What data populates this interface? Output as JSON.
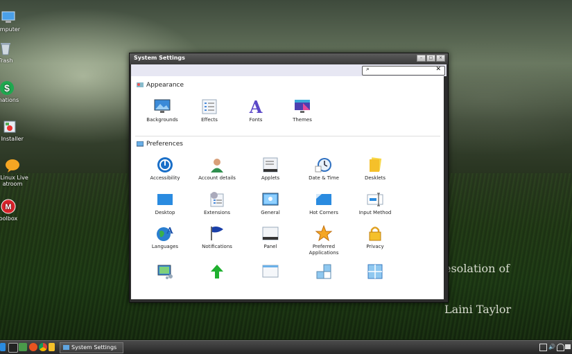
{
  "desktop": {
    "icons": [
      {
        "label": "omputer",
        "icon": "computer-icon"
      },
      {
        "label": "Trash",
        "icon": "trash-icon"
      },
      {
        "label": "onations",
        "icon": "donations-icon"
      },
      {
        "label": "e Installer",
        "icon": "installer-icon"
      },
      {
        "label": "uLinux Live\natroom",
        "icon": "chat-icon"
      },
      {
        "label": "oolbox",
        "icon": "toolbox-icon"
      }
    ],
    "quote": {
      "line": "esolation of",
      "author": "Laini Taylor"
    }
  },
  "window": {
    "title": "System Settings",
    "controls": [
      "minimize",
      "maximize",
      "close"
    ],
    "search": {
      "placeholder": "",
      "value": "",
      "icon": "search-icon",
      "clear_icon": "clear-icon"
    },
    "sections": [
      {
        "name": "Appearance",
        "icon": "appearance-icon",
        "items": [
          {
            "label": "Backgrounds",
            "icon": "backgrounds-icon"
          },
          {
            "label": "Effects",
            "icon": "effects-icon"
          },
          {
            "label": "Fonts",
            "icon": "fonts-icon"
          },
          {
            "label": "Themes",
            "icon": "themes-icon"
          }
        ]
      },
      {
        "name": "Preferences",
        "icon": "preferences-icon",
        "items": [
          {
            "label": "Accessibility",
            "icon": "accessibility-icon"
          },
          {
            "label": "Account details",
            "icon": "account-icon"
          },
          {
            "label": "Applets",
            "icon": "applets-icon"
          },
          {
            "label": "Date & Time",
            "icon": "clock-icon"
          },
          {
            "label": "Desklets",
            "icon": "desklets-icon"
          },
          {
            "label": "Desktop",
            "icon": "desktop-icon"
          },
          {
            "label": "Extensions",
            "icon": "extensions-icon"
          },
          {
            "label": "General",
            "icon": "general-icon"
          },
          {
            "label": "Hot Corners",
            "icon": "hot-corners-icon"
          },
          {
            "label": "Input Method",
            "icon": "input-method-icon"
          },
          {
            "label": "Languages",
            "icon": "languages-icon"
          },
          {
            "label": "Notifications",
            "icon": "notifications-icon"
          },
          {
            "label": "Panel",
            "icon": "panel-icon"
          },
          {
            "label": "Preferred\nApplications",
            "icon": "preferred-apps-icon"
          },
          {
            "label": "Privacy",
            "icon": "privacy-icon"
          },
          {
            "label": "",
            "icon": "network-icon"
          },
          {
            "label": "",
            "icon": "startup-icon"
          },
          {
            "label": "",
            "icon": "windows-icon"
          },
          {
            "label": "",
            "icon": "window-tiling-icon"
          },
          {
            "label": "",
            "icon": "workspaces-icon"
          }
        ]
      }
    ]
  },
  "panel": {
    "menu_icon": "menu-icon",
    "launchers": [
      "terminal-icon",
      "installer-icon",
      "ubuntu-icon",
      "chrome-icon",
      "files-icon"
    ],
    "task": {
      "label": "System Settings",
      "icon": "settings-task-icon"
    },
    "tray": [
      "network-tray-icon",
      "volume-icon",
      "wifi-icon",
      "keyboard-icon"
    ]
  },
  "colors": {
    "window_frame": "#2d2d2d",
    "toolbar": "#e7e7f3",
    "content_bg": "#ffffff",
    "accent_blue": "#3d8be0",
    "panel": "#2e2e2e"
  }
}
